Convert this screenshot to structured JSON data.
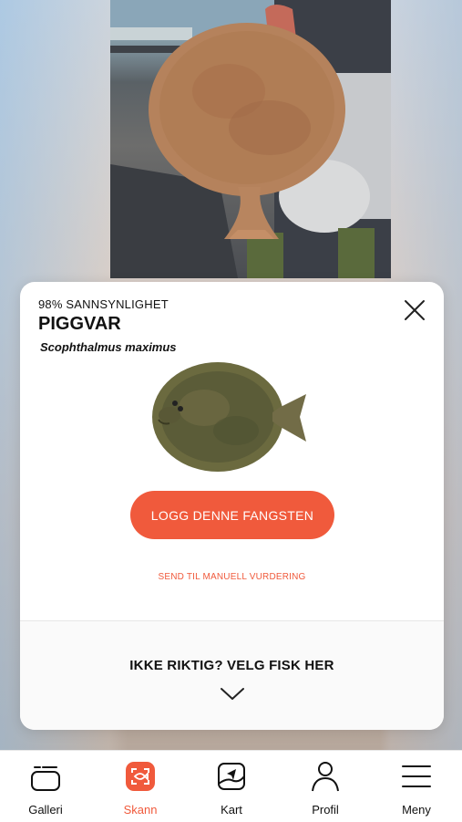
{
  "result": {
    "probability_label": "98% SANNSYNLIGHET",
    "fish_name": "PIGGVAR",
    "latin_name": "Scophthalmus maximus"
  },
  "actions": {
    "log_button": "LOGG DENNE FANGSTEN",
    "manual_review": "SEND TIL MANUELL VURDERING",
    "pick_fish": "IKKE RIKTIG? VELG FISK HER"
  },
  "tabs": [
    {
      "label": "Galleri",
      "icon": "gallery-icon"
    },
    {
      "label": "Skann",
      "icon": "scan-icon",
      "active": true
    },
    {
      "label": "Kart",
      "icon": "map-icon"
    },
    {
      "label": "Profil",
      "icon": "profile-icon"
    },
    {
      "label": "Meny",
      "icon": "menu-icon"
    }
  ],
  "colors": {
    "accent": "#f05a3c",
    "text": "#111111",
    "card": "#ffffff"
  }
}
